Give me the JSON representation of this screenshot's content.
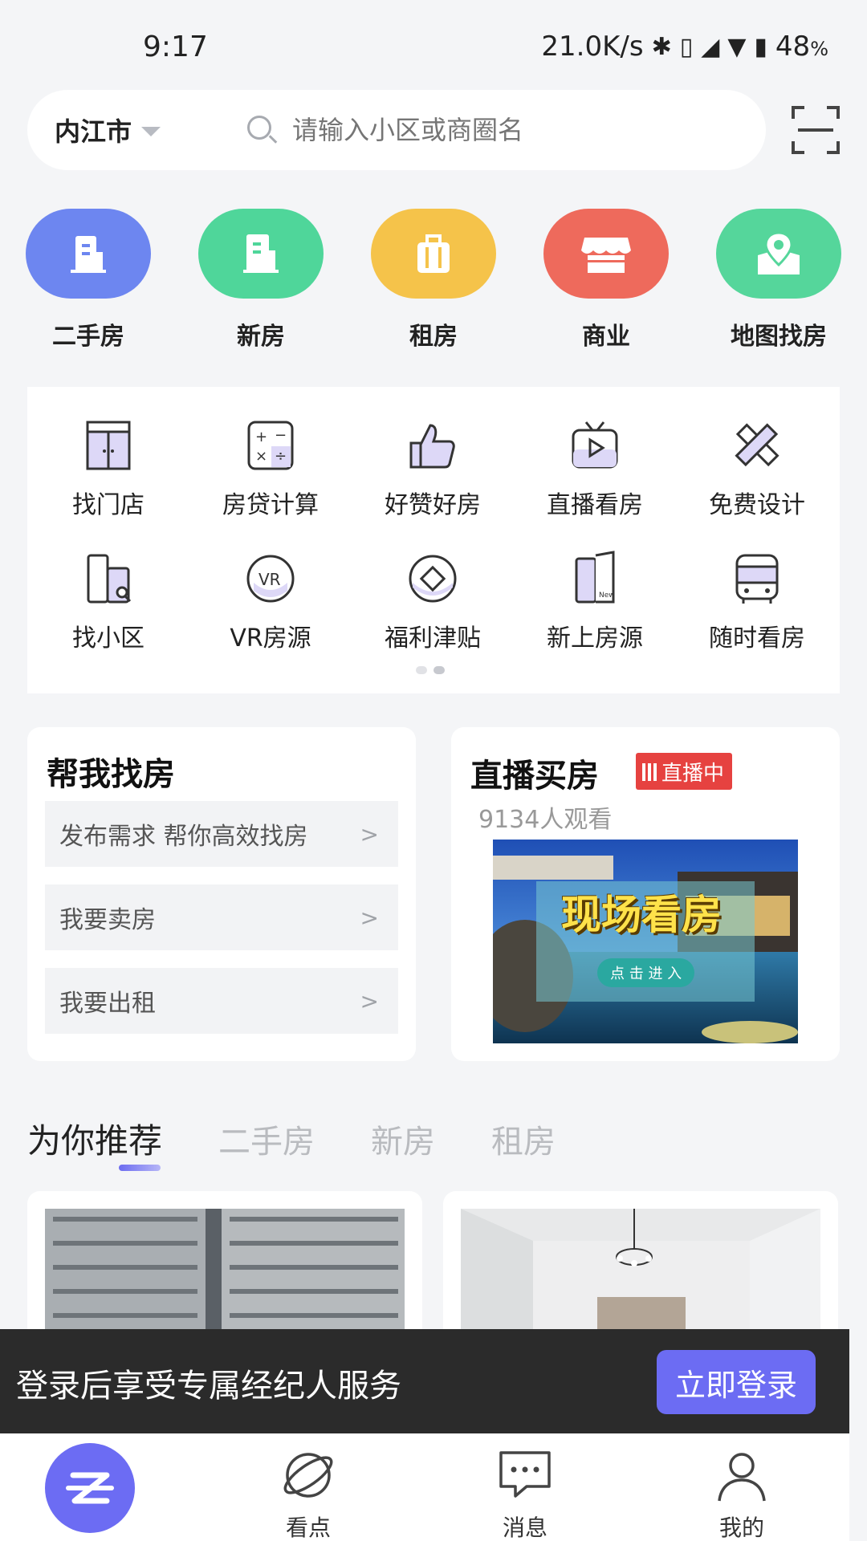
{
  "status_bar": {
    "time": "9:17",
    "network_speed": "21.0K/s",
    "battery_percent": "48",
    "battery_unit": "%",
    "icons": [
      "bluetooth-icon",
      "vibrate-icon",
      "hd-signal-icon",
      "wifi-icon",
      "battery-icon"
    ]
  },
  "search": {
    "city": "内江市",
    "placeholder": "请输入小区或商圈名"
  },
  "categories": [
    {
      "label": "二手房",
      "color": "#6d86f0",
      "icon": "building-icon"
    },
    {
      "label": "新房",
      "color": "#4fd69a",
      "icon": "new-building-icon"
    },
    {
      "label": "租房",
      "color": "#f5c34a",
      "icon": "suitcase-icon"
    },
    {
      "label": "商业",
      "color": "#ee6a5c",
      "icon": "storefront-icon"
    },
    {
      "label": "地图找房",
      "color": "#55d69b",
      "icon": "map-pin-icon"
    }
  ],
  "tools": [
    {
      "label": "找门店",
      "icon": "store-door-icon"
    },
    {
      "label": "房贷计算",
      "icon": "calculator-icon"
    },
    {
      "label": "好赞好房",
      "icon": "thumbs-up-icon"
    },
    {
      "label": "直播看房",
      "icon": "tv-play-icon"
    },
    {
      "label": "免费设计",
      "icon": "design-tools-icon"
    },
    {
      "label": "找小区",
      "icon": "community-search-icon"
    },
    {
      "label": "VR房源",
      "icon": "vr-icon"
    },
    {
      "label": "福利津贴",
      "icon": "coupon-icon"
    },
    {
      "label": "新上房源",
      "icon": "new-listing-icon"
    },
    {
      "label": "随时看房",
      "icon": "bus-icon"
    }
  ],
  "help_find": {
    "title": "帮我找房",
    "rows": [
      "发布需求 帮你高效找房",
      "我要卖房",
      "我要出租"
    ]
  },
  "live": {
    "title": "直播买房",
    "badge": "直播中",
    "viewers": "9134人观看",
    "thumb_text": "现场看房",
    "thumb_button": "点 击 进 入"
  },
  "recommend_tabs": [
    "为你推荐",
    "二手房",
    "新房",
    "租房"
  ],
  "login_banner": {
    "text": "登录后享受专属经纪人服务",
    "button": "立即登录"
  },
  "bottom_nav": {
    "items": [
      "看点",
      "消息",
      "我的"
    ]
  },
  "colors": {
    "accent": "#6c6cf3",
    "live_red": "#e64240"
  }
}
